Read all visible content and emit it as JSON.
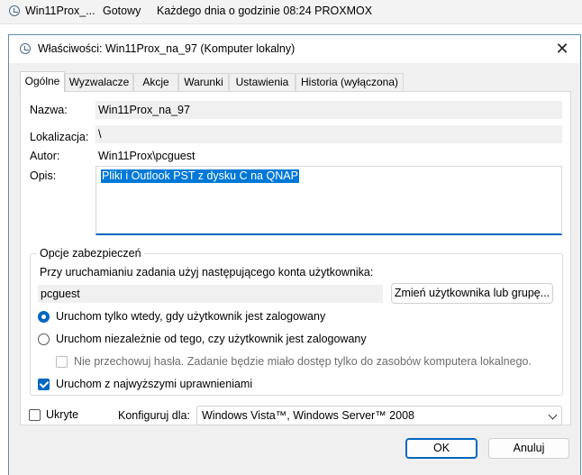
{
  "background_task": {
    "name": "Win11Prox_...",
    "status": "Gotowy",
    "trigger": "Każdego dnia o godzinie 08:24 PROXMOX"
  },
  "dialog": {
    "title": "Właściwości: Win11Prox_na_97 (Komputer lokalny)",
    "close_glyph": "✕"
  },
  "tabs": [
    {
      "label": "Ogólne",
      "active": true
    },
    {
      "label": "Wyzwalacze",
      "active": false
    },
    {
      "label": "Akcje",
      "active": false
    },
    {
      "label": "Warunki",
      "active": false
    },
    {
      "label": "Ustawienia",
      "active": false
    },
    {
      "label": "Historia (wyłączona)",
      "active": false
    }
  ],
  "general": {
    "name_label": "Nazwa:",
    "name_value": "Win11Prox_na_97",
    "location_label": "Lokalizacja:",
    "location_value": "\\",
    "author_label": "Autor:",
    "author_value": "Win11Prox\\pcguest",
    "description_label": "Opis:",
    "description_value": "Pliki i Outlook PST z dysku C na QNAP"
  },
  "security": {
    "group_title": "Opcje zabezpieczeń",
    "account_prompt": "Przy uruchamianiu zadania użyj następującego konta użytkownika:",
    "account_value": "pcguest",
    "change_user_button": "Zmień użytkownika lub grupę...",
    "radio_logged_on": {
      "label": "Uruchom tylko wtedy, gdy użytkownik jest zalogowany",
      "checked": true
    },
    "radio_any": {
      "label": "Uruchom niezależnie od tego, czy użytkownik jest zalogowany",
      "checked": false
    },
    "no_password": {
      "label": "Nie przechowuj hasła. Zadanie będzie miało dostęp tylko do zasobów komputera lokalnego.",
      "checked": false,
      "enabled": false
    },
    "highest_privileges": {
      "label": "Uruchom z najwyższymi uprawnieniami",
      "checked": true
    }
  },
  "footer": {
    "hidden_label": "Ukryte",
    "hidden_checked": false,
    "configure_label": "Konfiguruj dla:",
    "configure_value": "Windows Vista™, Windows Server™ 2008",
    "ok_button": "OK",
    "cancel_button": "Anuluj"
  },
  "colors": {
    "accent": "#0067c0",
    "dialog_border": "#5a8fa8",
    "selection": "#0078d7"
  }
}
